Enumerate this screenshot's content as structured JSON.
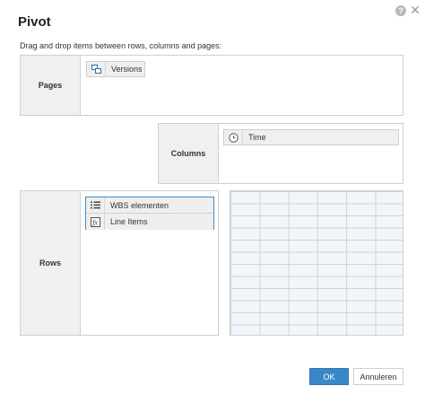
{
  "dialog": {
    "title": "Pivot",
    "help_symbol": "?",
    "close_symbol": "✕",
    "instruction": "Drag and drop items between rows, columns and pages:"
  },
  "pages": {
    "label": "Pages",
    "items": [
      {
        "label": "Versions",
        "icon": "versions-icon"
      }
    ]
  },
  "columns": {
    "label": "Columns",
    "items": [
      {
        "label": "Time",
        "icon": "clock-icon"
      }
    ]
  },
  "rows": {
    "label": "Rows",
    "items": [
      {
        "label": "WBS elementen",
        "icon": "list-icon"
      },
      {
        "label": "Line Items",
        "icon": "formula-icon"
      }
    ]
  },
  "buttons": {
    "ok": "OK",
    "cancel": "Annuleren"
  },
  "colors": {
    "accent": "#3a87c8",
    "grid_bg": "#f2f6fa",
    "label_bg": "#f0f0f0"
  }
}
